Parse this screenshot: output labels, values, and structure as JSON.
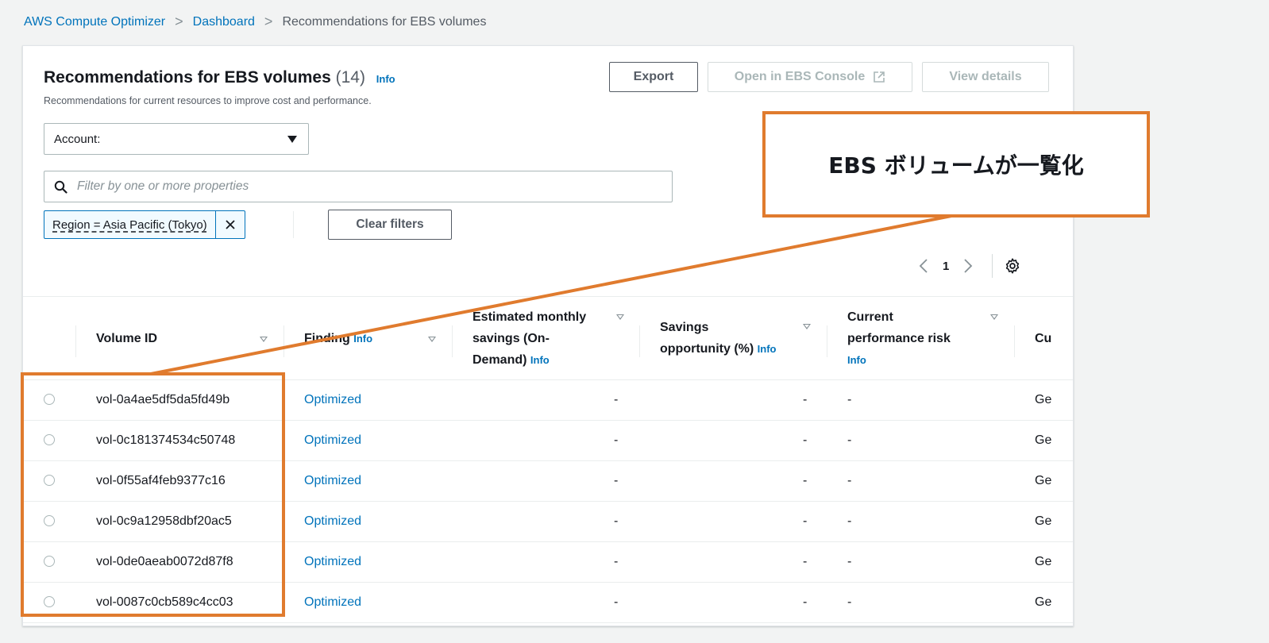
{
  "breadcrumb": {
    "items": [
      "AWS Compute Optimizer",
      "Dashboard",
      "Recommendations for EBS volumes"
    ]
  },
  "header": {
    "title": "Recommendations for EBS volumes",
    "count": "(14)",
    "info": "Info",
    "subtitle": "Recommendations for current resources to improve cost and performance."
  },
  "actions": {
    "export": "Export",
    "open_console": "Open in EBS Console",
    "view_details": "View details"
  },
  "account_select": {
    "label": "Account:"
  },
  "filter": {
    "placeholder": "Filter by one or more properties"
  },
  "token": {
    "label": "Region = Asia Pacific (Tokyo)"
  },
  "clear_filters": "Clear filters",
  "pagination": {
    "current_page": "1"
  },
  "table": {
    "columns": {
      "volume_id": "Volume ID",
      "finding": "Finding",
      "finding_info": "Info",
      "savings_l1": "Estimated monthly",
      "savings_l2": "savings (On-",
      "savings_l3": "Demand)",
      "savings_info": "Info",
      "opportunity_l1": "Savings",
      "opportunity_l2": "opportunity (%)",
      "opportunity_info": "Info",
      "risk_l1": "Current",
      "risk_l2": "performance risk",
      "risk_info": "Info",
      "current": "Cu"
    },
    "rows": [
      {
        "volume_id": "vol-0a4ae5df5da5fd49b",
        "finding": "Optimized",
        "savings": "-",
        "opportunity": "-",
        "risk": "-",
        "current": "Ge"
      },
      {
        "volume_id": "vol-0c181374534c50748",
        "finding": "Optimized",
        "savings": "-",
        "opportunity": "-",
        "risk": "-",
        "current": "Ge"
      },
      {
        "volume_id": "vol-0f55af4feb9377c16",
        "finding": "Optimized",
        "savings": "-",
        "opportunity": "-",
        "risk": "-",
        "current": "Ge"
      },
      {
        "volume_id": "vol-0c9a12958dbf20ac5",
        "finding": "Optimized",
        "savings": "-",
        "opportunity": "-",
        "risk": "-",
        "current": "Ge"
      },
      {
        "volume_id": "vol-0de0aeab0072d87f8",
        "finding": "Optimized",
        "savings": "-",
        "opportunity": "-",
        "risk": "-",
        "current": "Ge"
      },
      {
        "volume_id": "vol-0087c0cb589c4cc03",
        "finding": "Optimized",
        "savings": "-",
        "opportunity": "-",
        "risk": "-",
        "current": "Ge"
      }
    ]
  },
  "annotation": {
    "callout_text": "EBS ボリュームが一覧化"
  },
  "icons": {
    "search": "search-icon",
    "close": "close-icon",
    "external": "external-link-icon",
    "settings": "gear-icon",
    "prev": "chevron-left-icon",
    "next": "chevron-right-icon"
  },
  "colors": {
    "link": "#0073bb",
    "annotation": "#e07b2e",
    "text": "#16191f",
    "muted": "#545b64",
    "disabled": "#aab7b8"
  }
}
